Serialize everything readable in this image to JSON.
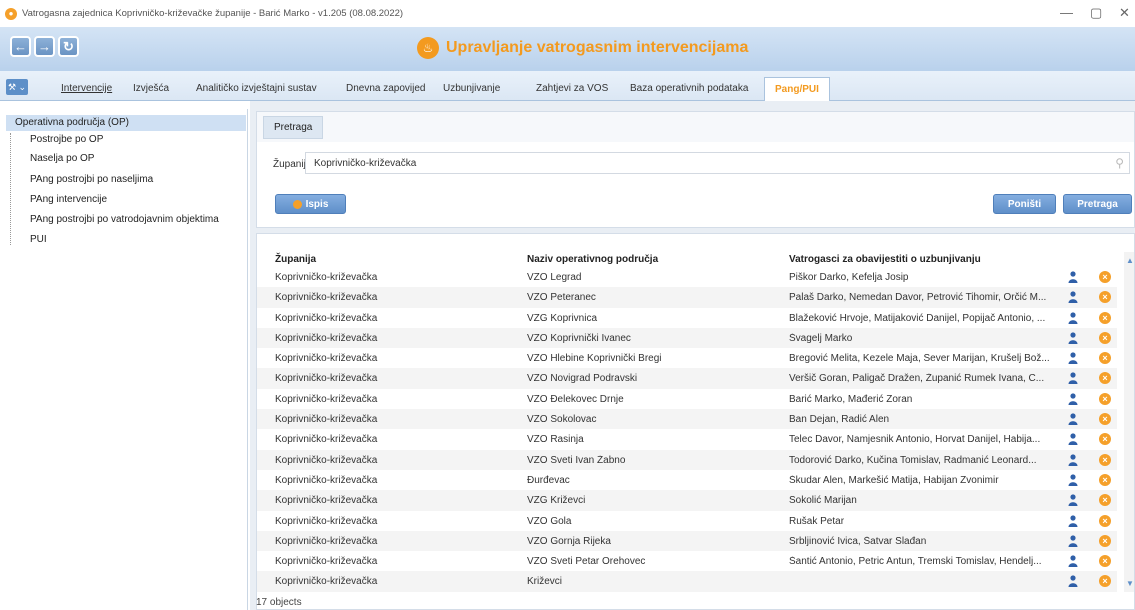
{
  "window": {
    "title": "Vatrogasna zajednica Koprivničko-križevačke županije - Barić Marko - v1.205 (08.08.2022)",
    "minimize": "—",
    "maximize": "▢",
    "close": "✕"
  },
  "header": {
    "app_title": "Upravljanje vatrogasnim intervencijama",
    "back_icon": "arrow-left-icon",
    "forward_icon": "arrow-right-icon",
    "refresh_icon": "refresh-icon",
    "accent": "#f39a1f"
  },
  "menu": {
    "tools_label": "⚒ ⌄",
    "items": [
      {
        "label": "Intervencije"
      },
      {
        "label": "Izvješća"
      },
      {
        "label": "Analitičko izvještajni sustav"
      },
      {
        "label": "Dnevna zapovijed"
      },
      {
        "label": "Uzbunjivanje"
      },
      {
        "label": "Zahtjevi za VOS"
      },
      {
        "label": "Baza operativnih podataka"
      },
      {
        "label": "Pang/PUI"
      }
    ]
  },
  "sidebar": {
    "items": [
      {
        "label": "Operativna područja (OP)"
      },
      {
        "label": "Postrojbe po OP"
      },
      {
        "label": "Naselja po OP"
      },
      {
        "label": "PAng postrojbi po naseljima"
      },
      {
        "label": "PAng intervencije"
      },
      {
        "label": "PAng postrojbi po vatrodojavnim objektima"
      },
      {
        "label": "PUI"
      }
    ]
  },
  "search": {
    "tab_label": "Pretraga",
    "county_label": "Županija",
    "county_value": "Koprivničko-križevačka",
    "print_button": "Ispis",
    "reset_button": "Poništi",
    "search_button": "Pretraga"
  },
  "grid": {
    "headers": [
      "Županija",
      "Naziv operativnog područja",
      "Vatrogasci za obavijestiti o uzbunjivanju"
    ],
    "rows": [
      {
        "county": "Koprivničko-križevačka",
        "area": "VZO Legrad",
        "firefighters": "Piškor Darko, Kefelja Josip"
      },
      {
        "county": "Koprivničko-križevačka",
        "area": "VZO Peteranec",
        "firefighters": "Palaš Darko, Nemedan Davor, Petrović Tihomir, Orčić M..."
      },
      {
        "county": "Koprivničko-križevačka",
        "area": "VZG Koprivnica",
        "firefighters": "Blažeković Hrvoje, Matijaković Danijel, Popijač Antonio, ..."
      },
      {
        "county": "Koprivničko-križevačka",
        "area": "VZO Koprivnički Ivanec",
        "firefighters": "Švagelj Marko"
      },
      {
        "county": "Koprivničko-križevačka",
        "area": "VZO Hlebine Koprivnički Bregi",
        "firefighters": "Bregović Melita, Kezele Maja, Sever Marijan, Krušelj Bož..."
      },
      {
        "county": "Koprivničko-križevačka",
        "area": "VZO Novigrad Podravski",
        "firefighters": "Veršič Goran, Paligač Dražen, Županić Rumek Ivana, C..."
      },
      {
        "county": "Koprivničko-križevačka",
        "area": "VZO Đelekovec Drnje",
        "firefighters": "Barić Marko, Mađerić Zoran"
      },
      {
        "county": "Koprivničko-križevačka",
        "area": "VZO Sokolovac",
        "firefighters": "Ban Dejan, Radić Alen"
      },
      {
        "county": "Koprivničko-križevačka",
        "area": "VZO Rasinja",
        "firefighters": "Telec Davor, Namjesnik Antonio, Horvat Danijel, Habija..."
      },
      {
        "county": "Koprivničko-križevačka",
        "area": "VZO Sveti Ivan Žabno",
        "firefighters": "Todorović Darko, Kučina Tomislav, Radmanić Leonard..."
      },
      {
        "county": "Koprivničko-križevačka",
        "area": "Đurđevac",
        "firefighters": "Škudar Alen, Markešić Matija, Habijan Zvonimir"
      },
      {
        "county": "Koprivničko-križevačka",
        "area": "VZG Križevci",
        "firefighters": "Sokolić Marijan"
      },
      {
        "county": "Koprivničko-križevačka",
        "area": "VZO Gola",
        "firefighters": "Rušak Petar"
      },
      {
        "county": "Koprivničko-križevačka",
        "area": "VZO Gornja Rijeka",
        "firefighters": "Srbljinović Ivica, Šatvar Slađan"
      },
      {
        "county": "Koprivničko-križevačka",
        "area": "VZO Sveti Petar Orehovec",
        "firefighters": "Šantić Antonio, Petric Antun, Tremski Tomislav, Hendelj..."
      },
      {
        "county": "Koprivničko-križevačka",
        "area": "Križevci",
        "firefighters": ""
      }
    ],
    "row_icons": [
      "person-icon",
      "delete-icon"
    ],
    "footer": "17 objects"
  }
}
